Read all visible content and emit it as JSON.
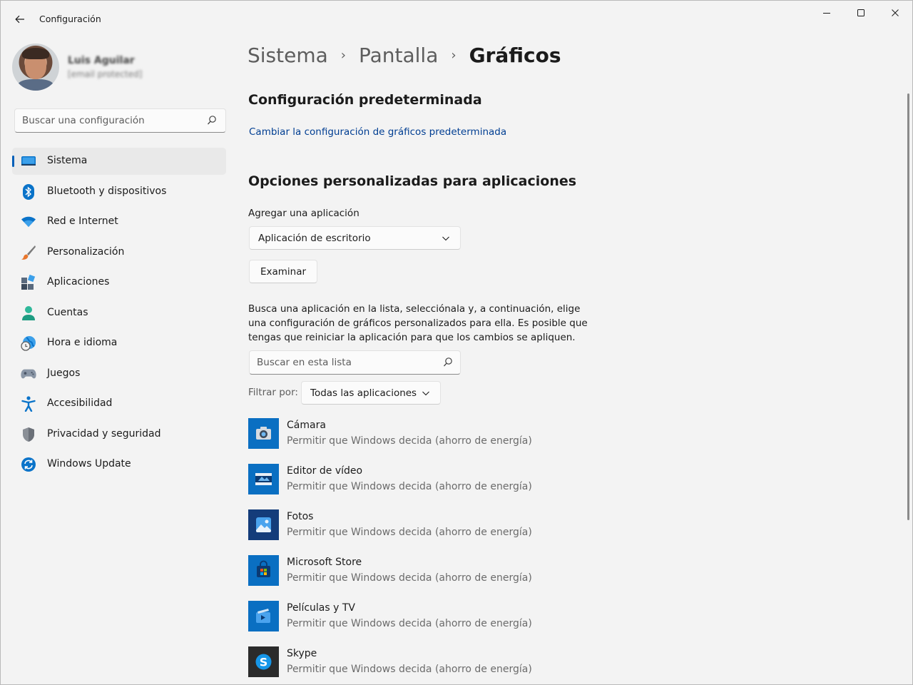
{
  "window": {
    "title": "Configuración"
  },
  "profile": {
    "name": "Luis Aguilar",
    "email": "[email protected]"
  },
  "sidebar": {
    "search_placeholder": "Buscar una configuración",
    "items": [
      {
        "label": "Sistema",
        "icon": "monitor-icon",
        "active": true
      },
      {
        "label": "Bluetooth y dispositivos",
        "icon": "bluetooth-icon"
      },
      {
        "label": "Red e Internet",
        "icon": "wifi-icon"
      },
      {
        "label": "Personalización",
        "icon": "brush-icon"
      },
      {
        "label": "Aplicaciones",
        "icon": "apps-icon"
      },
      {
        "label": "Cuentas",
        "icon": "account-icon"
      },
      {
        "label": "Hora e idioma",
        "icon": "clock-globe-icon"
      },
      {
        "label": "Juegos",
        "icon": "gamepad-icon"
      },
      {
        "label": "Accesibilidad",
        "icon": "accessibility-icon"
      },
      {
        "label": "Privacidad y seguridad",
        "icon": "shield-icon"
      },
      {
        "label": "Windows Update",
        "icon": "update-icon"
      }
    ]
  },
  "breadcrumb": {
    "items": [
      "Sistema",
      "Pantalla",
      "Gráficos"
    ]
  },
  "main": {
    "default_section_title": "Configuración predeterminada",
    "default_link": "Cambiar la configuración de gráficos predeterminada",
    "custom_section_title": "Opciones personalizadas para aplicaciones",
    "add_app_label": "Agregar una aplicación",
    "app_type_selected": "Aplicación de escritorio",
    "browse_label": "Examinar",
    "description": "Busca una aplicación en la lista, selecciónala y, a continuación, elige una configuración de gráficos personalizados para ella. Es posible que tengas que reiniciar la aplicación para que los cambios se apliquen.",
    "list_search_placeholder": "Buscar en esta lista",
    "filter_label": "Filtrar por:",
    "filter_selected": "Todas las aplicaciones",
    "apps": [
      {
        "name": "Cámara",
        "setting": "Permitir que Windows decida (ahorro de energía)",
        "icon": "camera-icon"
      },
      {
        "name": "Editor de vídeo",
        "setting": "Permitir que Windows decida (ahorro de energía)",
        "icon": "video-editor-icon"
      },
      {
        "name": "Fotos",
        "setting": "Permitir que Windows decida (ahorro de energía)",
        "icon": "photos-icon"
      },
      {
        "name": "Microsoft Store",
        "setting": "Permitir que Windows decida (ahorro de energía)",
        "icon": "store-icon"
      },
      {
        "name": "Películas y TV",
        "setting": "Permitir que Windows decida (ahorro de energía)",
        "icon": "movies-tv-icon"
      },
      {
        "name": "Skype",
        "setting": "Permitir que Windows decida (ahorro de energía)",
        "icon": "skype-icon"
      }
    ]
  },
  "colors": {
    "accent": "#005fb8",
    "link": "#003e92",
    "background": "#f3f3f3"
  }
}
